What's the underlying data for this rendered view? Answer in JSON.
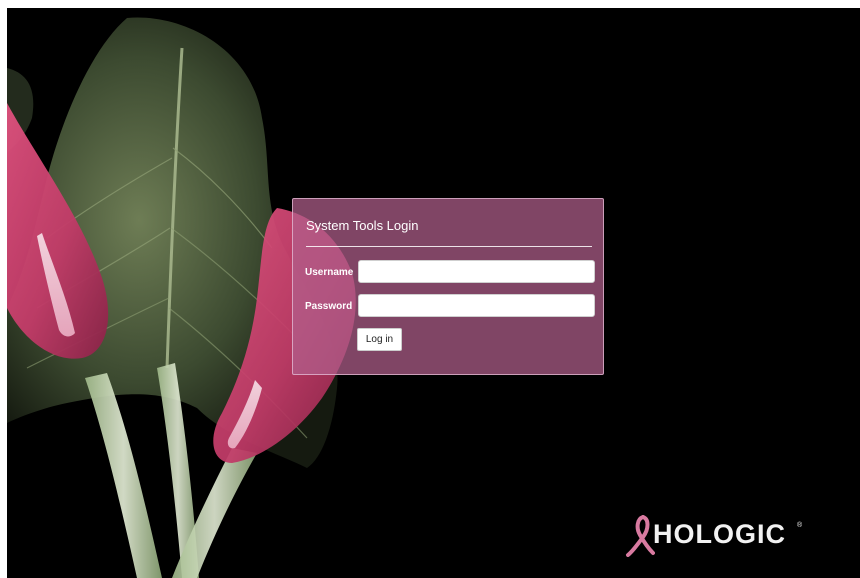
{
  "login": {
    "title": "System Tools Login",
    "username_label": "Username",
    "username_value": "",
    "password_label": "Password",
    "password_value": "",
    "submit_label": "Log in"
  },
  "brand": {
    "name": "HOLOGIC",
    "registered_mark": "®",
    "ribbon_icon": "pink-ribbon-icon"
  },
  "background": {
    "description_icon": "xray-calla-lily-artwork",
    "colors": {
      "backdrop": "#000000",
      "petal": "#d6497a",
      "leaf": "#5b6b48",
      "panel": "#b2608c"
    }
  }
}
